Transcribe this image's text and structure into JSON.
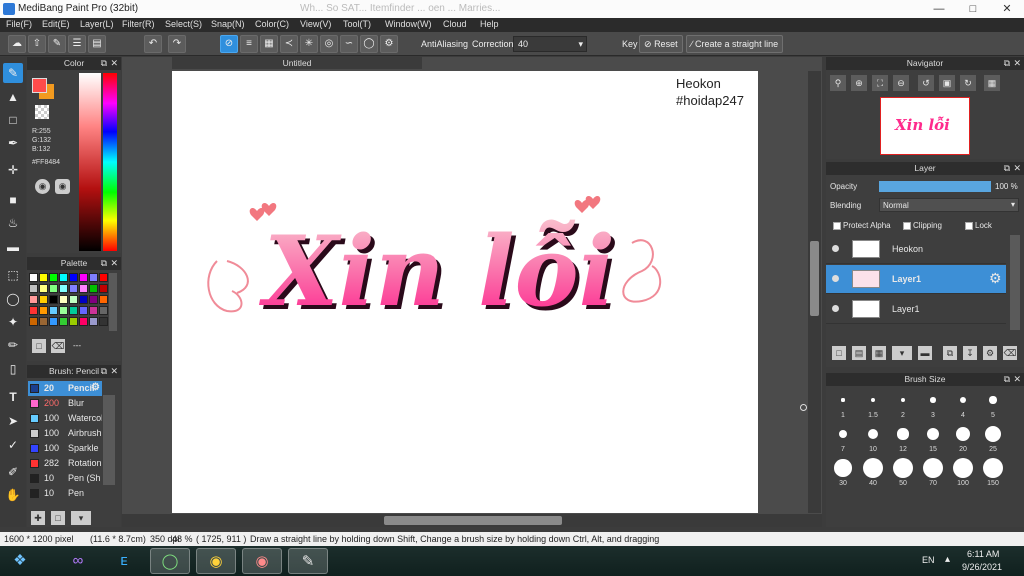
{
  "window": {
    "title": "MediBang Paint Pro (32bit)",
    "background_tabs": "Wh... So SAT... Itemfinder ... oen  ... Marries..."
  },
  "menu": [
    "File(F)",
    "Edit(E)",
    "Layer(L)",
    "Filter(R)",
    "Select(S)",
    "Snap(N)",
    "Color(C)",
    "View(V)",
    "Tool(T)",
    "Window(W)",
    "Cloud",
    "Help"
  ],
  "toolbar": {
    "antialiasing_label": "AntiAliasing",
    "correction_label": "Correction",
    "correction_value": "40",
    "key_label": "Key",
    "reset_label": "Reset",
    "straight_line_label": "Create a straight line"
  },
  "color_panel": {
    "title": "Color",
    "r": "R:255",
    "g": "G:132",
    "b": "B:132",
    "hex": "#FF8484",
    "primary": "#ff4b4b",
    "secondary": "#f29a1f"
  },
  "palette_panel": {
    "title": "Palette",
    "more_label": "---",
    "colors": [
      "#ffffff",
      "#ffff00",
      "#00ff00",
      "#00ffff",
      "#0000ff",
      "#ff00ff",
      "#7f7fff",
      "#ff0000",
      "#c0c0c0",
      "#ffff80",
      "#80ff80",
      "#80ffff",
      "#8080ff",
      "#ff80ff",
      "#00c000",
      "#c00000",
      "#ff9999",
      "#ffcc00",
      "#000000",
      "#ffffc0",
      "#c0ffc0",
      "#0000c0",
      "#800080",
      "#ff6600",
      "#ff3333",
      "#ff9900",
      "#66ccff",
      "#99ff99",
      "#00cc99",
      "#6666ff",
      "#cc3399",
      "#666666",
      "#cc6600",
      "#996633",
      "#3399ff",
      "#33cc33",
      "#99cc00",
      "#ff0066",
      "#9999cc",
      "#333333"
    ]
  },
  "brush_panel": {
    "title": "Brush: Pencil",
    "brushes": [
      {
        "size": "20",
        "name": "Pencil",
        "color": "#1a3f8f",
        "selected": true
      },
      {
        "size": "200",
        "name": "Blur",
        "color": "#ff66cc"
      },
      {
        "size": "100",
        "name": "Watercolor",
        "color": "#66ccff"
      },
      {
        "size": "100",
        "name": "Airbrush",
        "color": "#cccccc"
      },
      {
        "size": "100",
        "name": "Sparkle",
        "color": "#3344ff"
      },
      {
        "size": "282",
        "name": "Rotation",
        "color": "#ff3333"
      },
      {
        "size": "10",
        "name": "Pen (Sh",
        "color": "#222222"
      },
      {
        "size": "10",
        "name": "Pen",
        "color": "#222222"
      }
    ]
  },
  "document": {
    "tab_title": "Untitled",
    "watermark_name": "Heokon",
    "watermark_tag": "#hoidap247",
    "lettering": "Xin lỗi"
  },
  "navigator": {
    "title": "Navigator"
  },
  "layer_panel": {
    "title": "Layer",
    "opacity_label": "Opacity",
    "opacity_value": "100 %",
    "opacity_fraction": 1.0,
    "blending_label": "Blending",
    "blending_value": "Normal",
    "protect_alpha_label": "Protect Alpha",
    "clipping_label": "Clipping",
    "lock_label": "Lock",
    "layers": [
      {
        "name": "Heokon",
        "thumb_text": "Heokon\n#hoidap247",
        "selected": false
      },
      {
        "name": "Layer1",
        "selected": true
      },
      {
        "name": "Layer1",
        "selected": false
      }
    ]
  },
  "brush_size_panel": {
    "title": "Brush Size",
    "sizes": [
      "1",
      "1.5",
      "2",
      "3",
      "4",
      "5",
      "7",
      "10",
      "12",
      "15",
      "20",
      "25",
      "30",
      "40",
      "50",
      "70",
      "100",
      "150"
    ]
  },
  "status": {
    "dimensions": "1600 * 1200 pixel",
    "physical": "(11.6 * 8.7cm)",
    "dpi": "350 dpi",
    "zoom": "48 %",
    "cursor": "( 1725, 911 )",
    "hint": "Draw a straight line by holding down Shift, Change a brush size by holding down Ctrl, Alt, and dragging"
  },
  "taskbar": {
    "lang": "EN",
    "time": "6:11 AM",
    "date": "9/26/2021"
  }
}
